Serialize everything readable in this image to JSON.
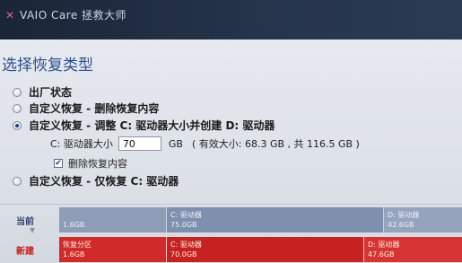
{
  "window": {
    "title": "VAIO Care 拯救大师"
  },
  "page": {
    "title": "选择恢复类型"
  },
  "options": [
    {
      "label": "出厂状态"
    },
    {
      "label": "自定义恢复 - 删除恢复内容"
    },
    {
      "label": "自定义恢复 - 调整 C: 驱动器大小并创建 D: 驱动器"
    },
    {
      "label": "自定义恢复 - 仅恢复 C: 驱动器"
    }
  ],
  "selected_option": 2,
  "resize": {
    "label": "C: 驱动器大小",
    "value": "70",
    "unit": "GB",
    "hint": "( 有效大小: 68.3 GB , 共 116.5 GB )"
  },
  "delete_recovery": {
    "label": "删除恢复内容",
    "checked": true
  },
  "partitions": {
    "current_label": "当前",
    "new_label": "新建",
    "current": [
      {
        "name": "",
        "size": "1.6GB"
      },
      {
        "name": "C: 驱动器",
        "size": "75.0GB"
      },
      {
        "name": "D: 驱动器",
        "size": "42.6GB"
      }
    ],
    "new": [
      {
        "name": "恢复分区",
        "size": "1.6GB"
      },
      {
        "name": "C: 驱动器",
        "size": "70.0GB"
      },
      {
        "name": "D: 驱动器",
        "size": "47.6GB"
      }
    ]
  }
}
